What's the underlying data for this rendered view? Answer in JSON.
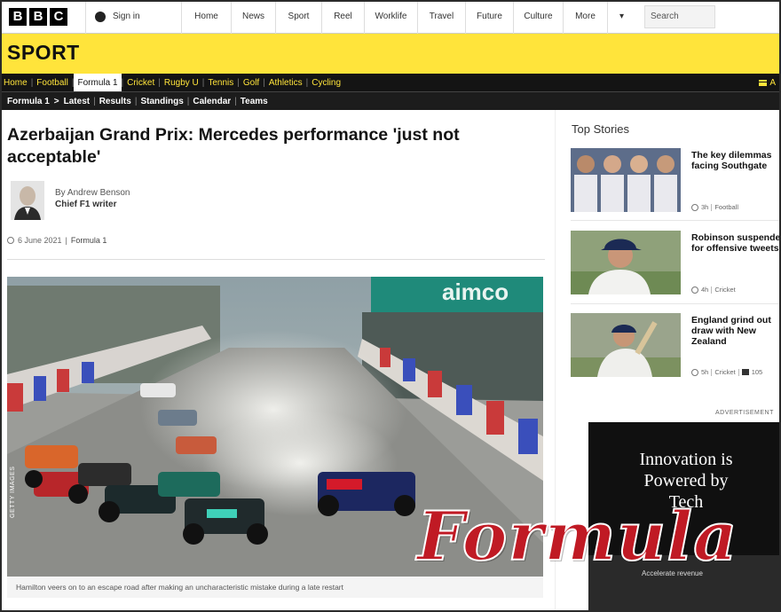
{
  "topbar": {
    "logo_letters": [
      "B",
      "B",
      "C"
    ],
    "sign_in": "Sign in",
    "nav": [
      "Home",
      "News",
      "Sport",
      "Reel",
      "Worklife",
      "Travel",
      "Future",
      "Culture",
      "More"
    ],
    "more_caret": "▾",
    "search_placeholder": "Search"
  },
  "sport_header": {
    "title": "SPORT"
  },
  "sport_nav": {
    "items": [
      "Home",
      "Football",
      "Formula 1",
      "Cricket",
      "Rugby U",
      "Tennis",
      "Golf",
      "Athletics",
      "Cycling"
    ],
    "active": "Formula 1",
    "all_label": "A"
  },
  "sub_nav": {
    "section": "Formula 1",
    "arrow": ">",
    "items": [
      "Latest",
      "Results",
      "Standings",
      "Calendar",
      "Teams"
    ]
  },
  "article": {
    "headline": "Azerbaijan Grand Prix: Mercedes performance 'just not acceptable'",
    "author_name": "By Andrew Benson",
    "author_role": "Chief F1 writer",
    "date": "6 June 2021",
    "section_link": "Formula 1",
    "caption": "Hamilton veers on to an escape road after making an uncharacteristic mistake during a late restart",
    "photo_credit": "GETTY IMAGES"
  },
  "sidebar": {
    "heading": "Top Stories",
    "stories": [
      {
        "title": "The key dilemmas facing Southgate",
        "age": "3h",
        "section": "Football",
        "comments": ""
      },
      {
        "title": "Robinson suspended for offensive tweets",
        "age": "4h",
        "section": "Cricket",
        "comments": ""
      },
      {
        "title": "England grind out draw with New Zealand",
        "age": "5h",
        "section": "Cricket",
        "comments": "105"
      }
    ],
    "advert_label": "ADVERTISEMENT",
    "advert_text_1": "Innovation is",
    "advert_text_2": "Powered by",
    "advert_text_3": "Tech",
    "advert_sub": "Accelerate revenue"
  },
  "overlay_text": "Formula",
  "colors": {
    "sport_yellow": "#ffe43b",
    "overlay_red": "#c01a24",
    "nav_dark": "#141414"
  }
}
